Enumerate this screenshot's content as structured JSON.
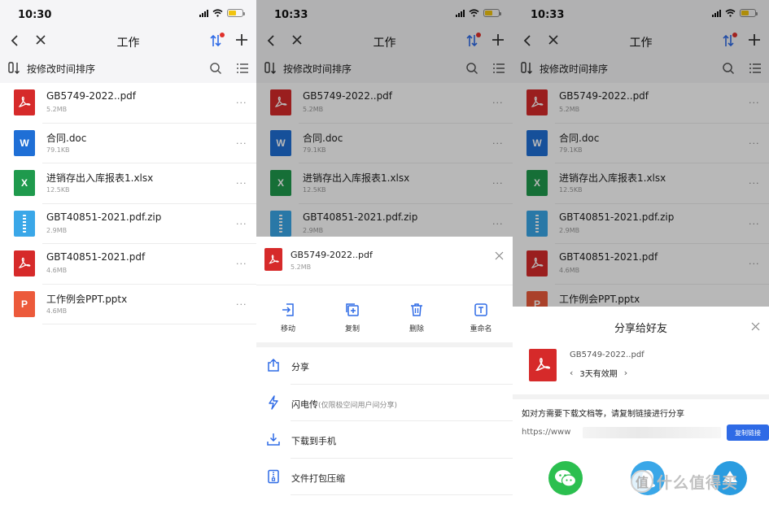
{
  "panels": [
    {
      "status": {
        "time": "10:30"
      },
      "nav": {
        "title": "工作"
      },
      "sortbar": {
        "label": "按修改时间排序"
      },
      "files": [
        {
          "name": "GB5749-2022..pdf",
          "size": "5.2MB",
          "type": "pdf",
          "more": "···"
        },
        {
          "name": "合同.doc",
          "size": "79.1KB",
          "type": "doc",
          "more": "···"
        },
        {
          "name": "进销存出入库报表1.xlsx",
          "size": "12.5KB",
          "type": "xls",
          "more": "···"
        },
        {
          "name": "GBT40851-2021.pdf.zip",
          "size": "2.9MB",
          "type": "zip",
          "more": "···"
        },
        {
          "name": "GBT40851-2021.pdf",
          "size": "4.6MB",
          "type": "pdf",
          "more": "···"
        },
        {
          "name": "工作例会PPT.pptx",
          "size": "4.6MB",
          "type": "ppt",
          "more": "···"
        }
      ]
    },
    {
      "status": {
        "time": "10:33"
      },
      "nav": {
        "title": "工作"
      },
      "sortbar": {
        "label": "按修改时间排序"
      },
      "files": [
        {
          "name": "GB5749-2022..pdf",
          "size": "5.2MB",
          "type": "pdf",
          "more": "···"
        },
        {
          "name": "合同.doc",
          "size": "79.1KB",
          "type": "doc",
          "more": "···"
        },
        {
          "name": "进销存出入库报表1.xlsx",
          "size": "12.5KB",
          "type": "xls",
          "more": "···"
        },
        {
          "name": "GBT40851-2021.pdf.zip",
          "size": "2.9MB",
          "type": "zip",
          "more": "···"
        }
      ],
      "sheet": {
        "file_name": "GB5749-2022..pdf",
        "file_size": "5.2MB",
        "actions": [
          {
            "label": "移动",
            "icon": "move-icon"
          },
          {
            "label": "复制",
            "icon": "copy-icon"
          },
          {
            "label": "删除",
            "icon": "trash-icon"
          },
          {
            "label": "重命名",
            "icon": "rename-icon"
          }
        ],
        "menu": [
          {
            "label": "分享",
            "sub": "",
            "icon": "share-icon"
          },
          {
            "label": "闪电传",
            "sub": "(仅限极空间用户间分享)",
            "icon": "lightning-icon"
          },
          {
            "label": "下载到手机",
            "sub": "",
            "icon": "download-icon"
          },
          {
            "label": "文件打包压缩",
            "sub": "",
            "icon": "archive-icon"
          }
        ]
      }
    },
    {
      "status": {
        "time": "10:33"
      },
      "nav": {
        "title": "工作"
      },
      "sortbar": {
        "label": "按修改时间排序"
      },
      "files": [
        {
          "name": "GB5749-2022..pdf",
          "size": "5.2MB",
          "type": "pdf",
          "more": "···"
        },
        {
          "name": "合同.doc",
          "size": "79.1KB",
          "type": "doc",
          "more": "···"
        },
        {
          "name": "进销存出入库报表1.xlsx",
          "size": "12.5KB",
          "type": "xls",
          "more": "···"
        },
        {
          "name": "GBT40851-2021.pdf.zip",
          "size": "2.9MB",
          "type": "zip",
          "more": "···"
        },
        {
          "name": "GBT40851-2021.pdf",
          "size": "4.6MB",
          "type": "pdf",
          "more": "···"
        },
        {
          "name": "工作例会PPT.pptx",
          "size": "",
          "type": "ppt",
          "more": ""
        }
      ],
      "share": {
        "title": "分享给好友",
        "file_name": "GB5749-2022..pdf",
        "validity": "3天有效期",
        "hint": "如对方需要下载文档等，请复制链接进行分享",
        "link_prefix": "https://www",
        "copy_label": "复制链接",
        "targets": [
          "wechat-icon",
          "qq-icon",
          "share-target-icon"
        ]
      }
    }
  ],
  "watermark": {
    "text": "什么值得买",
    "badge": "值"
  },
  "colors": {
    "pdf": "#d62a2a",
    "doc": "#1f6fd6",
    "xls": "#1f9a4d",
    "zip": "#3aa7e8",
    "ppt": "#ec5a3b",
    "accent": "#2f6be6",
    "badge": "#e0302b"
  }
}
